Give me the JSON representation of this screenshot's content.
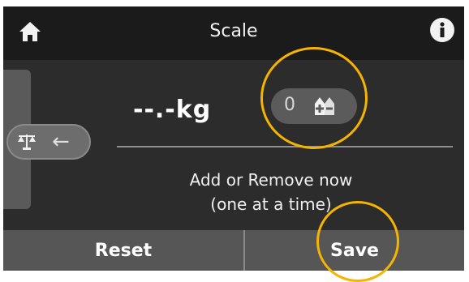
{
  "header": {
    "title": "Scale",
    "home_icon": "home-icon",
    "info_icon": "info-icon"
  },
  "main": {
    "weight_display": "--.-kg",
    "tare": {
      "count": "0",
      "icon": "weights-plus-minus-icon"
    },
    "side_tab": {
      "icon": "scale-balance-icon",
      "arrow": "←"
    },
    "message_line1": "Add or Remove now",
    "message_line2": "(one at a time)"
  },
  "footer": {
    "reset_label": "Reset",
    "save_label": "Save"
  },
  "colors": {
    "annotation_ring": "#f5b400",
    "header_bg": "#1b1b1b",
    "screen_bg": "#2c2c2c",
    "button_bg": "#565656"
  }
}
